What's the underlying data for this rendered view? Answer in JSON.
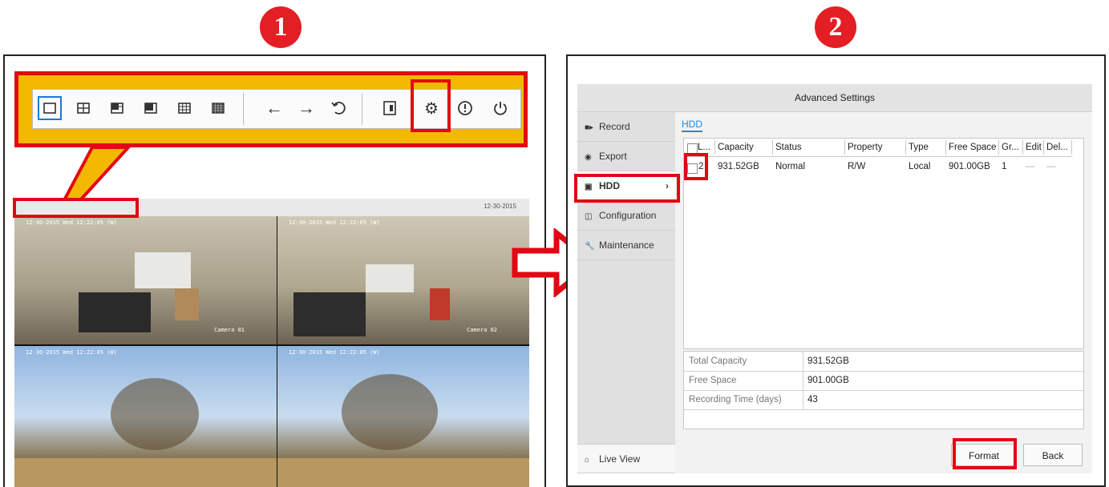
{
  "badges": [
    "1",
    "2"
  ],
  "panel1": {
    "toolbar_icons": [
      "single-view-icon",
      "quad-view-icon",
      "six-view-icon",
      "eight-view-icon",
      "nine-view-icon",
      "sixteen-view-icon",
      "previous-screen-icon",
      "next-screen-icon",
      "start-auto-switch-icon",
      "pip-icon",
      "settings-gear-icon",
      "alarm-status-icon",
      "power-icon"
    ],
    "monitor": {
      "date": "12-30-2015",
      "cameras": [
        {
          "timestamp": "12-30-2015 Wed 12:22:05 (W)",
          "label": "Camera 01"
        },
        {
          "timestamp": "12-30-2015 Wed 12:22:05 (W)",
          "label": "Camera 02"
        },
        {
          "timestamp": "12-30-2015 Wed 12:22:05 (W)",
          "label": ""
        },
        {
          "timestamp": "12-30-2015 Wed 12:22:05 (W)",
          "label": ""
        }
      ]
    }
  },
  "panel2": {
    "title": "Advanced Settings",
    "sidebar": [
      {
        "label": "Record",
        "icon": "record-icon"
      },
      {
        "label": "Export",
        "icon": "export-icon"
      },
      {
        "label": "HDD",
        "icon": "hdd-icon",
        "active": true
      },
      {
        "label": "Configuration",
        "icon": "configuration-icon"
      },
      {
        "label": "Maintenance",
        "icon": "maintenance-icon"
      }
    ],
    "live_view": "Live View",
    "tab": "HDD",
    "table": {
      "headers": [
        "L...",
        "Capacity",
        "Status",
        "Property",
        "Type",
        "Free Space",
        "Gr...",
        "Edit",
        "Del..."
      ],
      "row": {
        "label": "2",
        "capacity": "931.52GB",
        "status": "Normal",
        "property": "R/W",
        "type": "Local",
        "free_space": "901.00GB",
        "group": "1",
        "edit": "—",
        "delete": "—"
      }
    },
    "summary": [
      {
        "key": "Total Capacity",
        "value": "931.52GB"
      },
      {
        "key": "Free Space",
        "value": "901.00GB"
      },
      {
        "key": "Recording Time (days)",
        "value": "43"
      }
    ],
    "buttons": {
      "format": "Format",
      "back": "Back"
    }
  },
  "colors": {
    "highlight_red": "#e30613",
    "callout_yellow": "#f5b800",
    "link_blue": "#1a8ce0",
    "badge_red": "#e31e24"
  }
}
